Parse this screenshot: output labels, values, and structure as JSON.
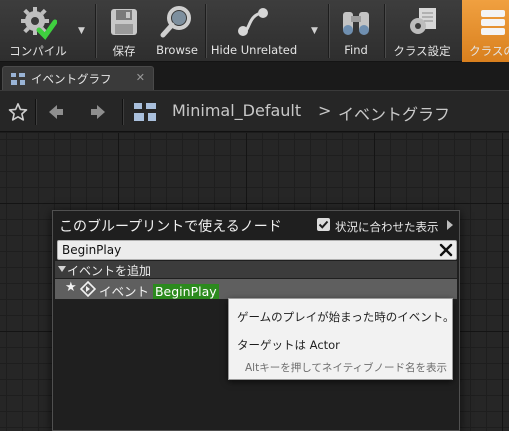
{
  "toolbar": {
    "buttons": [
      {
        "label": "コンパイル",
        "icon": "compile-gear-check-icon"
      },
      {
        "label": "保存",
        "icon": "save-disk-icon"
      },
      {
        "label": "Browse",
        "icon": "magnifier-icon"
      },
      {
        "label": "Hide Unrelated",
        "icon": "node-graph-icon"
      },
      {
        "label": "Find",
        "icon": "binoculars-icon"
      },
      {
        "label": "クラス設定",
        "icon": "class-settings-gear-icon"
      },
      {
        "label": "クラスの",
        "icon": "class-defaults-icon"
      }
    ],
    "accent": "#e38c2a"
  },
  "tab": {
    "label": "イベントグラフ",
    "icon": "graph-tab-icon",
    "close_glyph": "✕"
  },
  "breadcrumb": {
    "root": "Minimal_Default",
    "separator": ">",
    "current": "イベントグラフ"
  },
  "menu": {
    "title": "このブループリントで使えるノード",
    "context_sensitive": {
      "label": "状況に合わせた表示",
      "checked": true
    },
    "search": {
      "value": "BeginPlay"
    },
    "category": {
      "label": "イベントを追加"
    },
    "item": {
      "prefix": "イベント ",
      "match": "BeginPlay",
      "highlight_color": "#2c8a1e"
    }
  },
  "tooltip": {
    "description": "ゲームのプレイが始まった時のイベント。",
    "target": "ターゲットは Actor",
    "hint": "Altキーを押してネイティブノード名を表示"
  }
}
